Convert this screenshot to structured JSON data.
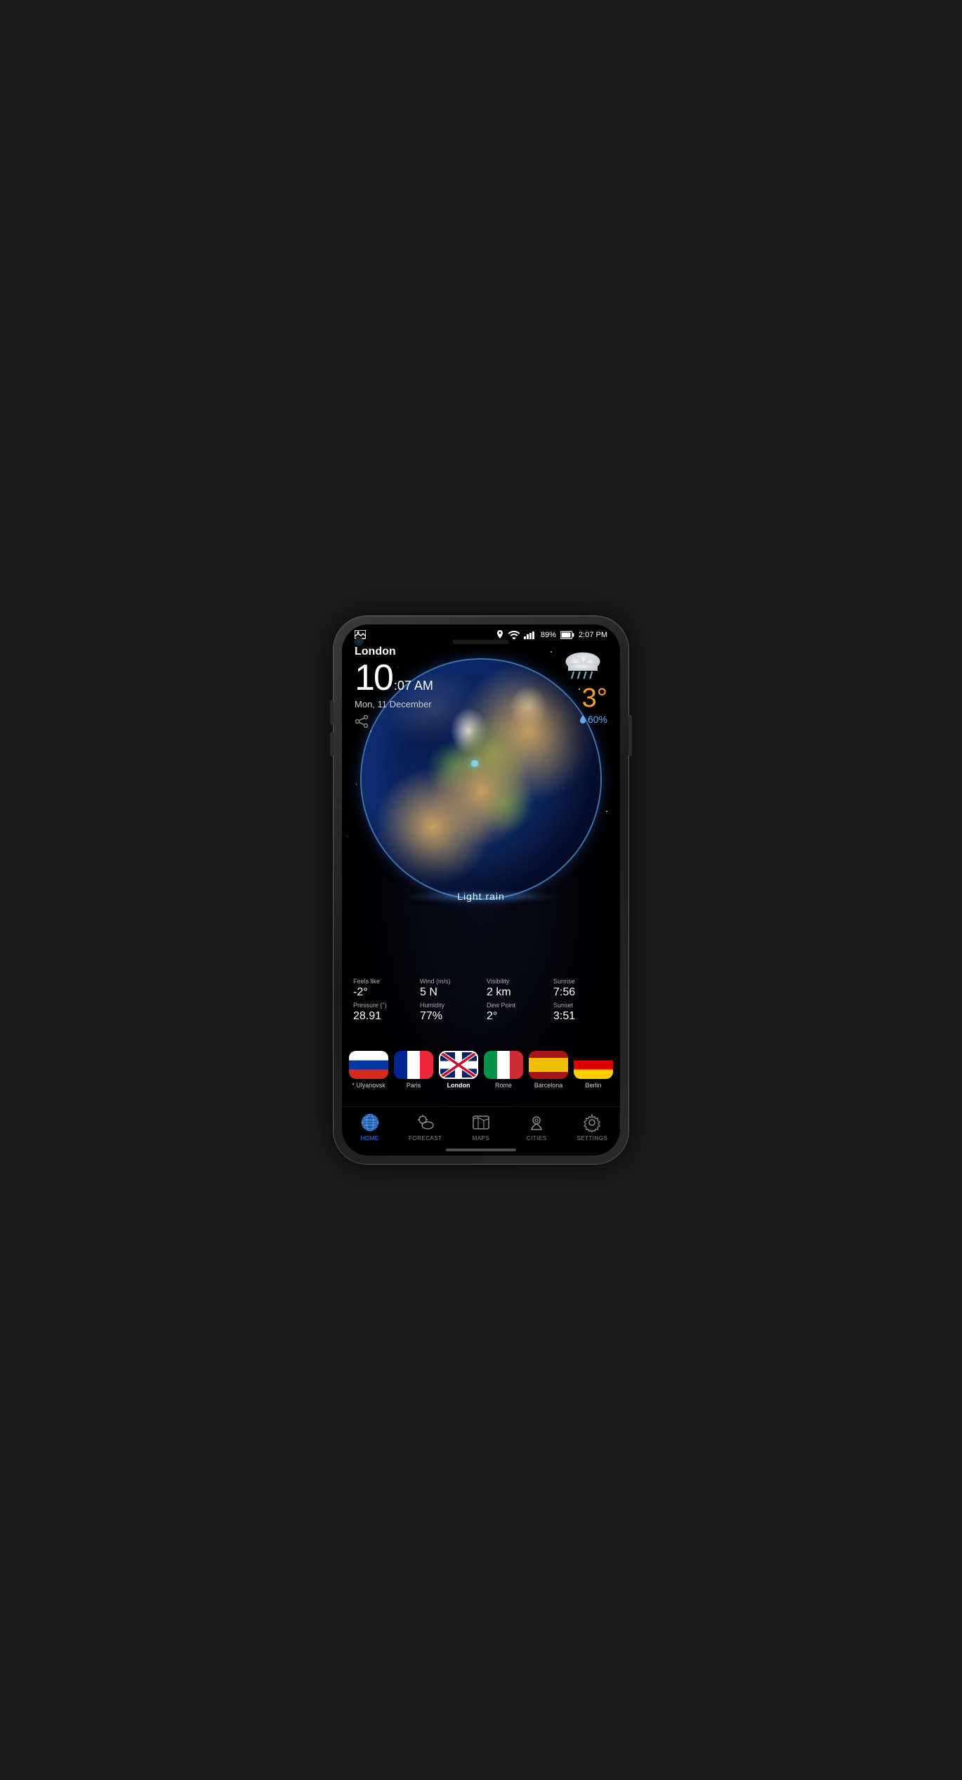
{
  "phone": {
    "screen": {
      "statusBar": {
        "left": {
          "icon": "image-icon"
        },
        "right": {
          "location": "📍",
          "wifi": "wifi",
          "signal": "signal",
          "battery": "89%",
          "time": "2:07 PM"
        }
      },
      "topInfo": {
        "city": "London",
        "timeBig": "10",
        "timeSmall": ":07 AM",
        "date": "Mon, 11 December",
        "tempColor": "#f0a030",
        "temperature": "3°",
        "precipitation": "60%",
        "condition": "Light rain"
      },
      "weatherStats": {
        "feelsLike": {
          "label": "Feels like",
          "value": "-2°"
        },
        "wind": {
          "label": "Wind (m/s)",
          "value": "5 N"
        },
        "visibility": {
          "label": "Visibility",
          "value": "2 km"
        },
        "sunrise": {
          "label": "Sunrise",
          "value": "7:56"
        },
        "pressure": {
          "label": "Pressure (\")",
          "value": "28.91"
        },
        "humidity": {
          "label": "Humidity",
          "value": "77%"
        },
        "dewPoint": {
          "label": "Dew Point",
          "value": "2°"
        },
        "sunset": {
          "label": "Sunset",
          "value": "3:51"
        }
      },
      "cities": [
        {
          "id": "ulyanovsk",
          "name": "* Ulyanovsk",
          "flag": "ru",
          "active": false
        },
        {
          "id": "paris",
          "name": "Paris",
          "flag": "fr",
          "active": false
        },
        {
          "id": "london",
          "name": "London",
          "flag": "uk",
          "active": true
        },
        {
          "id": "rome",
          "name": "Rome",
          "flag": "it",
          "active": false
        },
        {
          "id": "barcelona",
          "name": "Barcelona",
          "flag": "es",
          "active": false
        },
        {
          "id": "berlin",
          "name": "Berlin",
          "flag": "de",
          "active": false
        }
      ],
      "bottomNav": [
        {
          "id": "home",
          "label": "HOME",
          "active": true
        },
        {
          "id": "forecast",
          "label": "FORECAST",
          "active": false
        },
        {
          "id": "maps",
          "label": "MAPS",
          "active": false
        },
        {
          "id": "cities",
          "label": "CITIES",
          "active": false
        },
        {
          "id": "settings",
          "label": "SETTINGS",
          "active": false
        }
      ]
    }
  }
}
